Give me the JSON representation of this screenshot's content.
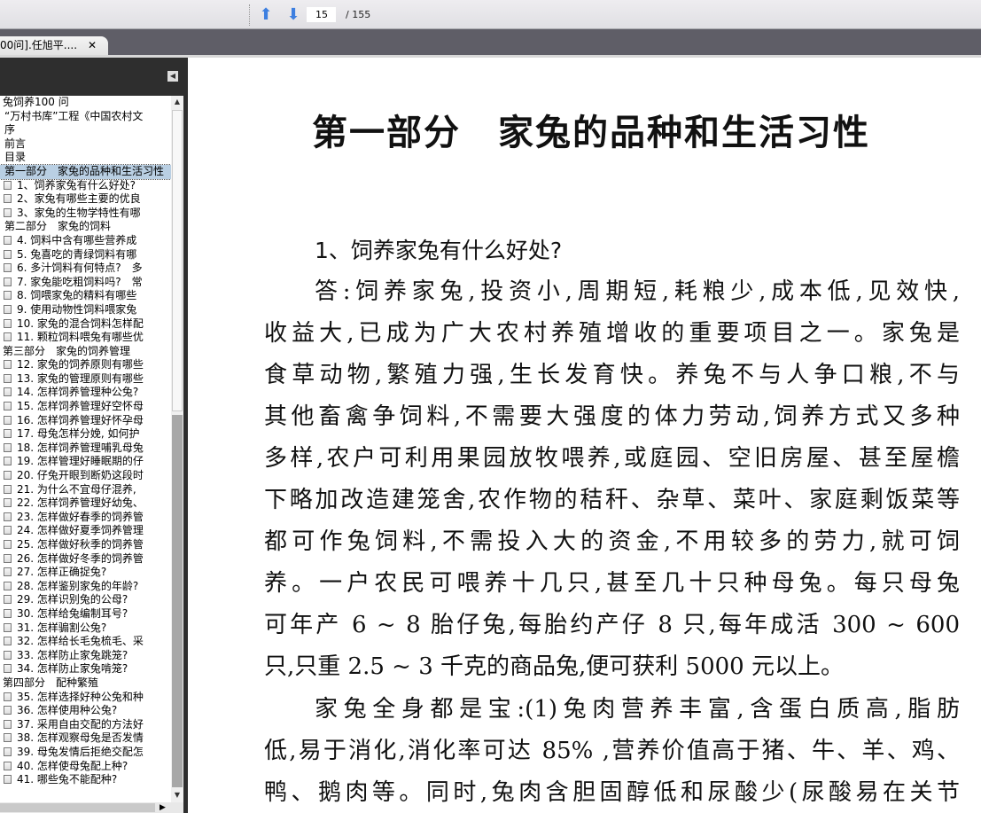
{
  "toolbar": {
    "page_current": "15",
    "page_total": "/ 155"
  },
  "tab": {
    "label": "00问].任旭平....",
    "close": "✕"
  },
  "outline": [
    {
      "t": "兔饲养100 问",
      "icon": false,
      "indent": 0
    },
    {
      "t": "“万村书库”工程《中国农村文",
      "icon": false,
      "indent": 1
    },
    {
      "t": "序",
      "icon": false,
      "indent": 1
    },
    {
      "t": "前言",
      "icon": false,
      "indent": 1
    },
    {
      "t": "目录",
      "icon": false,
      "indent": 1
    },
    {
      "t": "第一部分　家兔的品种和生活习性",
      "icon": false,
      "indent": 1,
      "selected": true
    },
    {
      "t": "1、饲养家兔有什么好处?",
      "icon": true
    },
    {
      "t": "2、家兔有哪些主要的优良",
      "icon": true
    },
    {
      "t": "3、家兔的生物学特性有哪",
      "icon": true
    },
    {
      "t": "第二部分　家兔的饲料",
      "icon": false,
      "indent": 1
    },
    {
      "t": "4. 饲料中含有哪些营养成",
      "icon": true
    },
    {
      "t": "5. 兔喜吃的青绿饲料有哪",
      "icon": true
    },
    {
      "t": "6. 多汁饲料有何特点?　多",
      "icon": true
    },
    {
      "t": "7. 家兔能吃粗饲料吗?　常",
      "icon": true
    },
    {
      "t": "8. 饲喂家兔的精料有哪些",
      "icon": true
    },
    {
      "t": "9. 使用动物性饲料喂家兔",
      "icon": true
    },
    {
      "t": "10. 家兔的混合饲料怎样配",
      "icon": true
    },
    {
      "t": "11. 颗粒饲料喂兔有哪些优",
      "icon": true
    },
    {
      "t": "第三部分　家兔的饲养管理",
      "icon": false,
      "indent": 0
    },
    {
      "t": "12. 家兔的饲养原则有哪些",
      "icon": true
    },
    {
      "t": "13. 家兔的管理原则有哪些",
      "icon": true
    },
    {
      "t": "14. 怎样饲养管理种公兔?",
      "icon": true
    },
    {
      "t": "15. 怎样饲养管理好空怀母",
      "icon": true
    },
    {
      "t": "16. 怎样饲养管理好怀孕母",
      "icon": true
    },
    {
      "t": "17. 母兔怎样分娩, 如何护",
      "icon": true
    },
    {
      "t": "18. 怎样饲养管理哺乳母兔",
      "icon": true
    },
    {
      "t": "19. 怎样管理好睡眠期的仔",
      "icon": true
    },
    {
      "t": "20. 仔兔开眼到断奶这段时",
      "icon": true
    },
    {
      "t": "21. 为什么不宜母仔混养,",
      "icon": true
    },
    {
      "t": "22. 怎样饲养管理好幼兔、",
      "icon": true
    },
    {
      "t": "23. 怎样做好春季的饲养管",
      "icon": true
    },
    {
      "t": "24. 怎样做好夏季饲养管理",
      "icon": true
    },
    {
      "t": "25. 怎样做好秋季的饲养管",
      "icon": true
    },
    {
      "t": "26. 怎样做好冬季的饲养管",
      "icon": true
    },
    {
      "t": "27. 怎样正确捉兔?",
      "icon": true
    },
    {
      "t": "28. 怎样鉴别家兔的年龄?",
      "icon": true
    },
    {
      "t": "29. 怎样识别兔的公母?",
      "icon": true
    },
    {
      "t": "30. 怎样给兔编制耳号?",
      "icon": true
    },
    {
      "t": "31. 怎样骟割公兔?",
      "icon": true
    },
    {
      "t": "32. 怎样给长毛兔梳毛、采",
      "icon": true
    },
    {
      "t": "33. 怎样防止家兔跳笼?",
      "icon": true
    },
    {
      "t": "34. 怎样防止家兔啃笼?",
      "icon": true
    },
    {
      "t": "第四部分　配种繁殖",
      "icon": false,
      "indent": 0
    },
    {
      "t": "35. 怎样选择好种公兔和种",
      "icon": true
    },
    {
      "t": "36. 怎样使用种公兔?",
      "icon": true
    },
    {
      "t": "37. 采用自由交配的方法好",
      "icon": true
    },
    {
      "t": "38. 怎样观察母兔是否发情",
      "icon": true
    },
    {
      "t": "39. 母兔发情后拒绝交配怎",
      "icon": true
    },
    {
      "t": "40. 怎样使母兔配上种?",
      "icon": true
    },
    {
      "t": "41. 哪些兔不能配种?",
      "icon": true
    }
  ],
  "page": {
    "title": "第一部分　家兔的品种和生活习性",
    "heading": "1、饲养家兔有什么好处?",
    "lines": [
      {
        "t": "答:饲养家兔,投资小,周期短,耗粮少,成本低,见效快,",
        "ind": true
      },
      {
        "t": "收益大,已成为广大农村养殖增收的重要项目之一。家兔是"
      },
      {
        "t": "食草动物,繁殖力强,生长发育快。养兔不与人争口粮,不与"
      },
      {
        "t": "其他畜禽争饲料,不需要大强度的体力劳动,饲养方式又多种"
      },
      {
        "t": "多样,农户可利用果园放牧喂养,或庭园、空旧房屋、甚至屋檐"
      },
      {
        "t": "下略加改造建笼舍,农作物的秸秆、杂草、菜叶、家庭剩饭菜等"
      },
      {
        "t": "都可作兔饲料,不需投入大的资金,不用较多的劳力,就可饲"
      },
      {
        "t": "养。一户农民可喂养十几只,甚至几十只种母兔。每只母兔"
      },
      {
        "t": "可年产 6 ~ 8 胎仔兔,每胎约产仔 8 只,每年成活 300 ~ 600"
      },
      {
        "t": "只,只重 2.5 ~ 3 千克的商品兔,便可获利 5000 元以上。",
        "last": true
      },
      {
        "t": "家兔全身都是宝:(1)兔肉营养丰富,含蛋白质高,脂肪",
        "ind": true,
        "gap": true
      },
      {
        "t": "低,易于消化,消化率可达 85% ,营养价值高于猪、牛、羊、鸡、"
      },
      {
        "t": "鸭、鹅肉等。同时,兔肉含胆固醇低和尿酸少(尿酸易在关节"
      }
    ]
  }
}
